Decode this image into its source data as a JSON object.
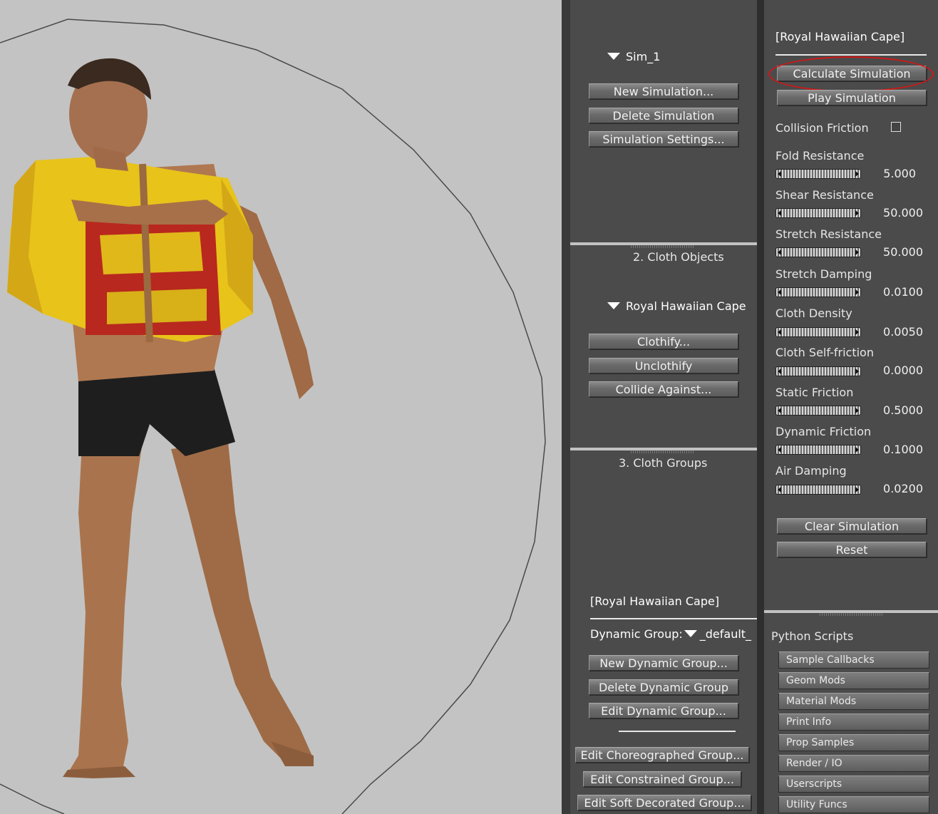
{
  "viewport": {
    "figure": "3D figure in Royal Hawaiian Cape"
  },
  "simulation": {
    "name": "Sim_1",
    "buttons": [
      "New Simulation...",
      "Delete Simulation",
      "Simulation Settings..."
    ]
  },
  "cloth_objects": {
    "title": "2. Cloth Objects",
    "object_name": "Royal Hawaiian Cape",
    "buttons": [
      "Clothify...",
      "Unclothify",
      "Collide Against..."
    ]
  },
  "cloth_groups": {
    "title": "3. Cloth Groups",
    "selected": "[Royal Hawaiian Cape]",
    "dynamic_group_label": "Dynamic Group:",
    "dynamic_group_value": "_default_",
    "buttons": [
      "New Dynamic Group...",
      "Delete Dynamic Group",
      "Edit Dynamic Group..."
    ],
    "more_buttons": [
      "Edit Choreographed Group...",
      "Edit Constrained Group...",
      "Edit Soft Decorated Group..."
    ]
  },
  "dynamics": {
    "selected": "[Royal Hawaiian Cape]",
    "calculate": "Calculate Simulation",
    "play": "Play Simulation",
    "collision_friction": "Collision Friction",
    "params": [
      {
        "label": "Fold Resistance",
        "value": "5.000"
      },
      {
        "label": "Shear Resistance",
        "value": "50.000"
      },
      {
        "label": "Stretch Resistance",
        "value": "50.000"
      },
      {
        "label": "Stretch Damping",
        "value": "0.0100"
      },
      {
        "label": "Cloth Density",
        "value": "0.0050"
      },
      {
        "label": "Cloth Self-friction",
        "value": "0.0000"
      },
      {
        "label": "Static Friction",
        "value": "0.5000"
      },
      {
        "label": "Dynamic Friction",
        "value": "0.1000"
      },
      {
        "label": "Air Damping",
        "value": "0.0200"
      }
    ],
    "clear": "Clear Simulation",
    "reset": "Reset",
    "highlight_color": "#d01818"
  },
  "python": {
    "title": "Python Scripts",
    "buttons": [
      "Sample Callbacks",
      "Geom Mods",
      "Material Mods",
      "Print Info",
      "Prop Samples",
      "Render / IO",
      "Userscripts",
      "Utility Funcs"
    ]
  }
}
